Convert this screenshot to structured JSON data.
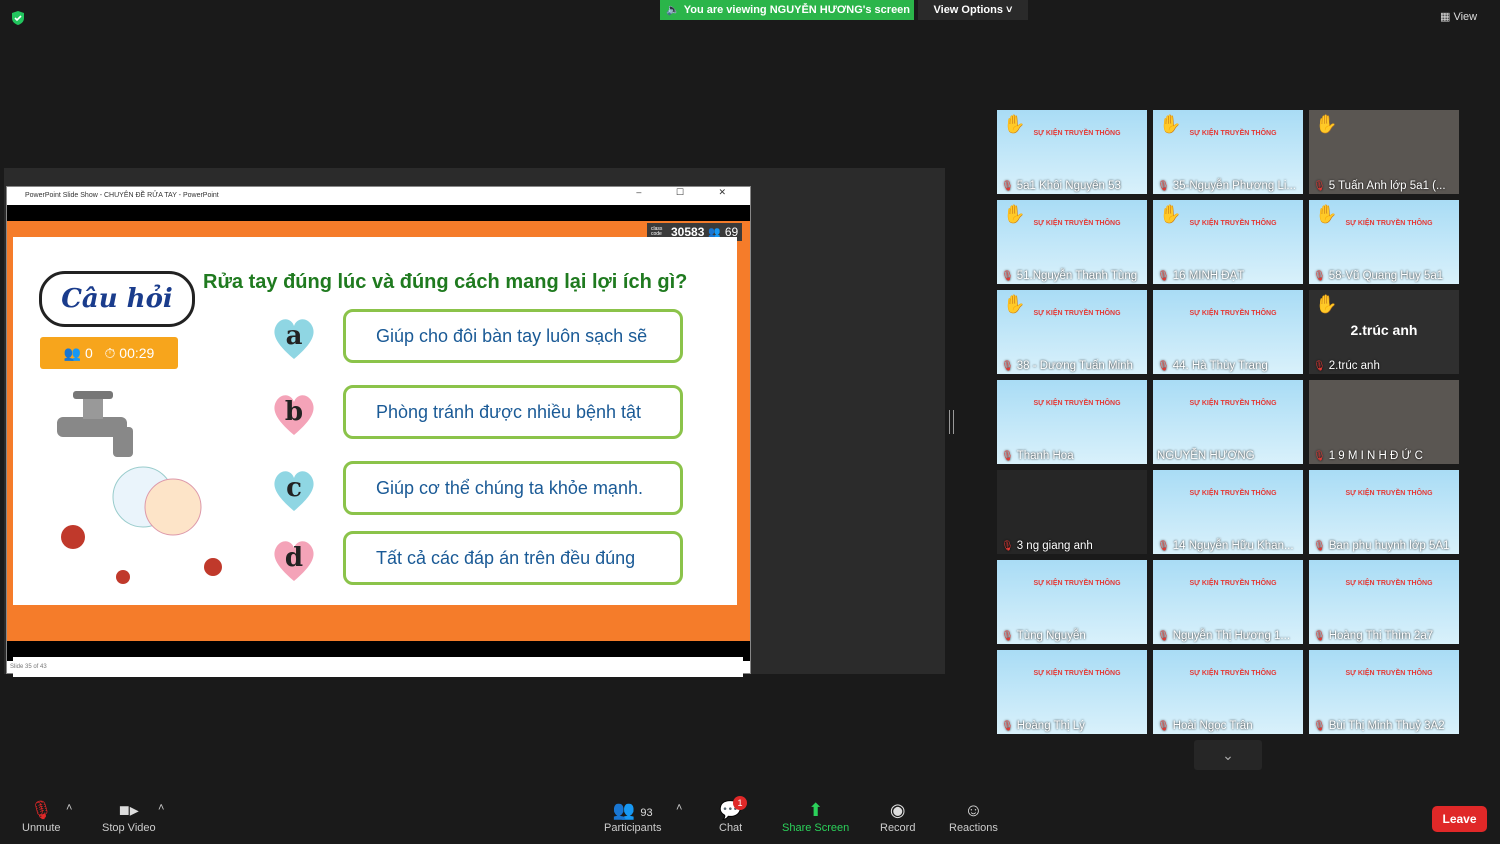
{
  "top": {
    "viewing_banner": "You are viewing NGUYỄN HƯƠNG's screen",
    "view_options": "View Options",
    "view_button": "View"
  },
  "ppt": {
    "window_title": "PowerPoint Slide Show - CHUYÊN ĐỀ RỬA TAY - PowerPoint",
    "class_code_label": "class code",
    "class_code": "30583",
    "participant_count": "69",
    "badge_text": "Câu hỏi",
    "question": "Rửa tay đúng lúc và đúng cách mang lại lợi ích gì?",
    "timer_people": "0",
    "timer_time": "00:29",
    "answers": [
      {
        "letter": "a",
        "text": "Giúp cho đôi bàn tay luôn sạch sẽ",
        "color": "#8fd6e3"
      },
      {
        "letter": "b",
        "text": "Phòng tránh được nhiều bệnh tật",
        "color": "#f4a3b8"
      },
      {
        "letter": "c",
        "text": "Giúp cơ thể chúng ta khỏe mạnh.",
        "color": "#8fd6e3"
      },
      {
        "letter": "d",
        "text": "Tất cả các đáp án trên đều đúng",
        "color": "#f4a3b8"
      }
    ],
    "status": "Slide 35 of 43"
  },
  "gallery": [
    {
      "name": "5a1 Khôi Nguyên 53",
      "hand": true,
      "poster": true
    },
    {
      "name": "35-Nguyễn Phương Li...",
      "hand": true,
      "poster": true
    },
    {
      "name": "5 Tuấn Anh lớp 5a1 (...",
      "hand": true,
      "poster": false
    },
    {
      "name": "51.Nguyễn Thanh Tùng",
      "hand": true,
      "poster": true
    },
    {
      "name": "16 MINH ĐẠT",
      "hand": true,
      "poster": true
    },
    {
      "name": "58-Vũ Quang Huy 5a1",
      "hand": true,
      "poster": true
    },
    {
      "name": "38 - Dương Tuấn Minh",
      "hand": true,
      "poster": true
    },
    {
      "name": "44. Hà Thùy Trang",
      "hand": false,
      "poster": true
    },
    {
      "name": "2.trúc anh",
      "hand": true,
      "poster": false,
      "center": "2.trúc anh"
    },
    {
      "name": "Thanh Hoa",
      "hand": false,
      "poster": true
    },
    {
      "name": "NGUYỄN HƯƠNG",
      "hand": false,
      "poster": true,
      "active": true,
      "nomic": true
    },
    {
      "name": "1 9 M I N H Đ Ứ C",
      "hand": false,
      "poster": false
    },
    {
      "name": "3 ng giang anh",
      "hand": false,
      "poster": false,
      "blank": true
    },
    {
      "name": "14 Nguyễn Hữu Khan...",
      "hand": false,
      "poster": true
    },
    {
      "name": "Ban phụ huynh lớp 5A1",
      "hand": false,
      "poster": true
    },
    {
      "name": "Tùng Nguyễn",
      "hand": false,
      "poster": true
    },
    {
      "name": "Nguyễn Thị Hương 1...",
      "hand": false,
      "poster": true
    },
    {
      "name": "Hoàng Thị Thìm 2a7",
      "hand": false,
      "poster": true
    },
    {
      "name": "Hoàng Thị Lý",
      "hand": false,
      "poster": true
    },
    {
      "name": "Hoài Ngọc Trân",
      "hand": false,
      "poster": true
    },
    {
      "name": "Bùi Thị Minh Thuỷ 3A2",
      "hand": false,
      "poster": true
    }
  ],
  "poster_title": "SỰ KIỆN TRUYỀN THÔNG",
  "toolbar": {
    "unmute": "Unmute",
    "stop_video": "Stop Video",
    "participants": "Participants",
    "participants_count": "93",
    "chat": "Chat",
    "chat_badge": "1",
    "share_screen": "Share Screen",
    "record": "Record",
    "reactions": "Reactions",
    "leave": "Leave"
  },
  "colors": {
    "accent_green": "#2bb54a",
    "leave_red": "#e02828",
    "slide_orange": "#f57c2a"
  }
}
